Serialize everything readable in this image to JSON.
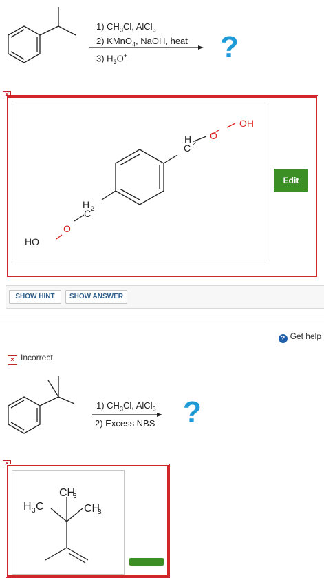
{
  "question1": {
    "conditions": [
      "1) CH",
      "3",
      "Cl, AlCl",
      "3",
      "2) KMnO",
      "4",
      ", NaOH, heat",
      "3) H",
      "3",
      "O",
      "+"
    ],
    "question_mark": "?",
    "answer_labels": {
      "oh": "OH",
      "o": "O",
      "h2": "H",
      "h2_sub": "2",
      "c": "C",
      "ho": "HO"
    },
    "edit_label": "Edit",
    "hint_label": "SHOW HINT",
    "answer_label": "SHOW ANSWER"
  },
  "help": {
    "label": "Get help",
    "icon": "?"
  },
  "status": {
    "icon": "×",
    "text": "Incorrect."
  },
  "question2": {
    "conditions": [
      "1) CH",
      "3",
      "Cl, AlCl",
      "3",
      "2) Excess NBS"
    ],
    "question_mark": "?",
    "answer_labels": {
      "ch3": "CH",
      "sub3": "3",
      "h3c_h": "H",
      "h3c_c": "C"
    }
  },
  "colors": {
    "accent": "#1e9ad6",
    "error": "#d0262c",
    "edit": "#3c8f25",
    "oxygen": "#e02020"
  }
}
